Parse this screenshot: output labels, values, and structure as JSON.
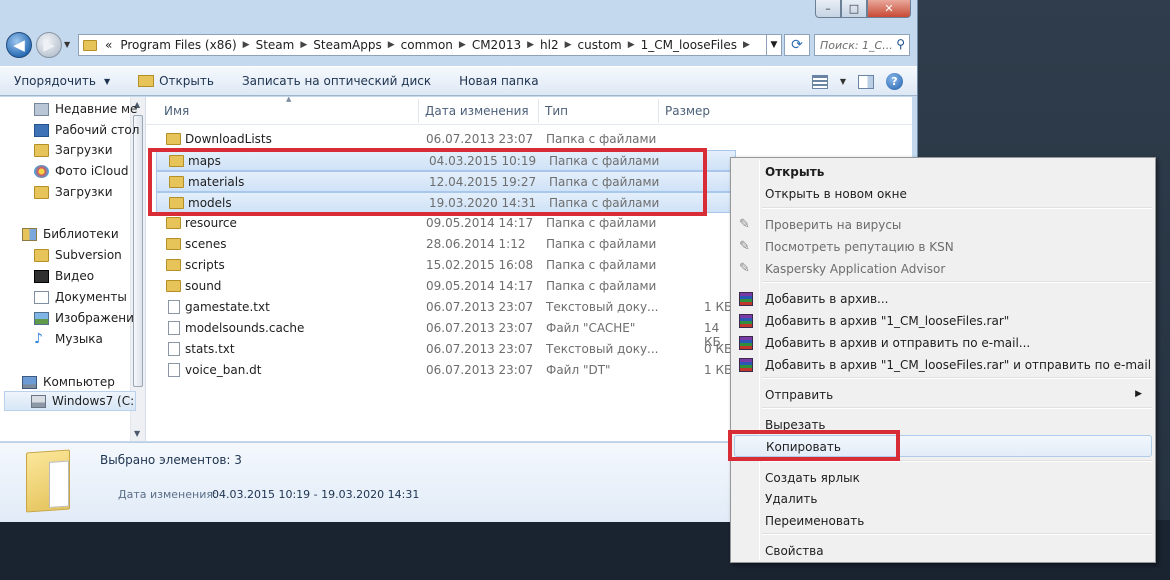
{
  "address": {
    "segments": [
      "Program Files (x86)",
      "Steam",
      "SteamApps",
      "common",
      "CM2013",
      "hl2",
      "custom",
      "1_CM_looseFiles"
    ],
    "overflow": "«",
    "search_placeholder": "Поиск: 1_C..."
  },
  "toolbar": {
    "organize": "Упорядочить",
    "open": "Открыть",
    "burn": "Записать на оптический диск",
    "new_folder": "Новая папка"
  },
  "nav": {
    "items": [
      {
        "label": "Недавние ме",
        "icon": "recent-places-icon"
      },
      {
        "label": "Рабочий стол",
        "icon": "desktop-icon"
      },
      {
        "label": "Загрузки",
        "icon": "downloads-folder-icon"
      },
      {
        "label": "Фото iCloud",
        "icon": "icloud-photos-icon"
      },
      {
        "label": "Загрузки",
        "icon": "downloads-folder-icon"
      },
      {
        "label": "Библиотеки",
        "icon": "libraries-icon"
      },
      {
        "label": "Subversion",
        "icon": "folder-icon"
      },
      {
        "label": "Видео",
        "icon": "video-library-icon"
      },
      {
        "label": "Документы",
        "icon": "documents-library-icon"
      },
      {
        "label": "Изображени",
        "icon": "pictures-library-icon"
      },
      {
        "label": "Музыка",
        "icon": "music-library-icon"
      },
      {
        "label": "Компьютер",
        "icon": "computer-icon"
      },
      {
        "label": "Windows7 (C:",
        "icon": "drive-icon"
      }
    ]
  },
  "columns": {
    "name": "Имя",
    "date": "Дата изменения",
    "type": "Тип",
    "size": "Размер"
  },
  "files": [
    {
      "name": "DownloadLists",
      "date": "06.07.2013 23:07",
      "type": "Папка с файлами",
      "size": "",
      "kind": "folder",
      "selected": false
    },
    {
      "name": "maps",
      "date": "04.03.2015 10:19",
      "type": "Папка с файлами",
      "size": "",
      "kind": "folder",
      "selected": true
    },
    {
      "name": "materials",
      "date": "12.04.2015 19:27",
      "type": "Папка с файлами",
      "size": "",
      "kind": "folder",
      "selected": true
    },
    {
      "name": "models",
      "date": "19.03.2020 14:31",
      "type": "Папка с файлами",
      "size": "",
      "kind": "folder",
      "selected": true
    },
    {
      "name": "resource",
      "date": "09.05.2014 14:17",
      "type": "Папка с файлами",
      "size": "",
      "kind": "folder",
      "selected": false
    },
    {
      "name": "scenes",
      "date": "28.06.2014 1:12",
      "type": "Папка с файлами",
      "size": "",
      "kind": "folder",
      "selected": false
    },
    {
      "name": "scripts",
      "date": "15.02.2015 16:08",
      "type": "Папка с файлами",
      "size": "",
      "kind": "folder",
      "selected": false
    },
    {
      "name": "sound",
      "date": "09.05.2014 14:17",
      "type": "Папка с файлами",
      "size": "",
      "kind": "folder",
      "selected": false
    },
    {
      "name": "gamestate.txt",
      "date": "06.07.2013 23:07",
      "type": "Текстовый доку...",
      "size": "1 КБ",
      "kind": "file",
      "selected": false
    },
    {
      "name": "modelsounds.cache",
      "date": "06.07.2013 23:07",
      "type": "Файл \"CACHE\"",
      "size": "14 КБ",
      "kind": "file",
      "selected": false
    },
    {
      "name": "stats.txt",
      "date": "06.07.2013 23:07",
      "type": "Текстовый доку...",
      "size": "0 КБ",
      "kind": "file",
      "selected": false
    },
    {
      "name": "voice_ban.dt",
      "date": "06.07.2013 23:07",
      "type": "Файл \"DT\"",
      "size": "1 КБ",
      "kind": "file",
      "selected": false
    }
  ],
  "details": {
    "count": "Выбрано элементов: 3",
    "date_label": "Дата изменения:",
    "date_value": "04.03.2015 10:19 - 19.03.2020 14:31"
  },
  "context_menu": {
    "items": [
      {
        "label": "Открыть",
        "style": "bold",
        "icon": ""
      },
      {
        "label": "Открыть в новом окне",
        "style": "",
        "icon": ""
      },
      {
        "sep": true
      },
      {
        "label": "Проверить на вирусы",
        "style": "disabled",
        "icon": "kaspersky-icon"
      },
      {
        "label": "Посмотреть репутацию в KSN",
        "style": "disabled",
        "icon": "kaspersky-icon"
      },
      {
        "label": "Kaspersky Application Advisor",
        "style": "disabled",
        "icon": "kaspersky-icon"
      },
      {
        "sep": true
      },
      {
        "label": "Добавить в архив...",
        "style": "",
        "icon": "winrar-icon"
      },
      {
        "label": "Добавить в архив \"1_CM_looseFiles.rar\"",
        "style": "",
        "icon": "winrar-icon"
      },
      {
        "label": "Добавить в архив и отправить по e-mail...",
        "style": "",
        "icon": "winrar-icon"
      },
      {
        "label": "Добавить в архив \"1_CM_looseFiles.rar\" и отправить по e-mail",
        "style": "",
        "icon": "winrar-icon"
      },
      {
        "sep": true
      },
      {
        "label": "Отправить",
        "style": "",
        "icon": "",
        "submenu": true
      },
      {
        "sep": true
      },
      {
        "label": "Вырезать",
        "style": "",
        "icon": ""
      },
      {
        "label": "Копировать",
        "style": "hover",
        "icon": ""
      },
      {
        "sep": true
      },
      {
        "label": "Создать ярлык",
        "style": "",
        "icon": ""
      },
      {
        "label": "Удалить",
        "style": "",
        "icon": ""
      },
      {
        "label": "Переименовать",
        "style": "",
        "icon": ""
      },
      {
        "sep": true
      },
      {
        "label": "Свойства",
        "style": "",
        "icon": ""
      }
    ]
  },
  "colors": {
    "highlight_red": "#d82d36",
    "selection_blue": "#cfe2f7",
    "folder_yellow": "#e7c45a"
  }
}
